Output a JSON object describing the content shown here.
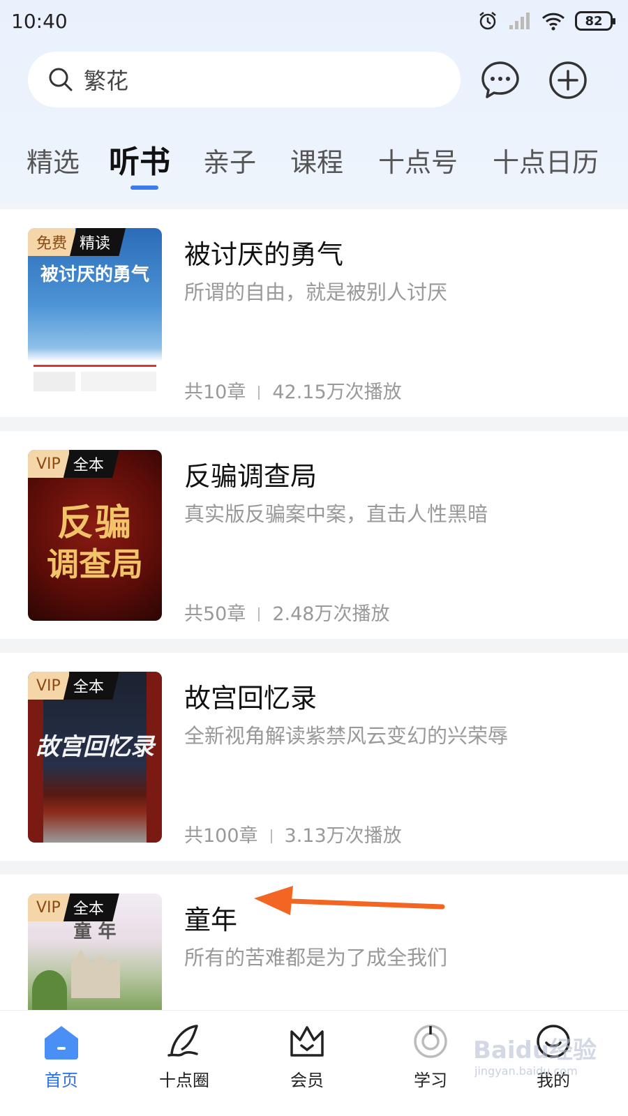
{
  "status_bar": {
    "time": "10:40",
    "battery": "82"
  },
  "search": {
    "placeholder": "繁花"
  },
  "tabs": [
    "精选",
    "听书",
    "亲子",
    "课程",
    "十点号",
    "十点日历"
  ],
  "active_tab": "听书",
  "books": [
    {
      "title": "被讨厌的勇气",
      "desc": "所谓的自由，就是被别人讨厌",
      "chapters": "共10章",
      "plays": "42.15万次播放",
      "badge_left": "免费",
      "badge_right": "精读",
      "cover_title": "被讨厌的勇气"
    },
    {
      "title": "反骗调查局",
      "desc": "真实版反骗案中案，直击人性黑暗",
      "chapters": "共50章",
      "plays": "2.48万次播放",
      "badge_left": "VIP",
      "badge_right": "全本",
      "cover_title_1": "反骗",
      "cover_title_2": "调查局"
    },
    {
      "title": "故宫回忆录",
      "desc": "全新视角解读紫禁风云变幻的兴荣辱",
      "chapters": "共100章",
      "plays": "3.13万次播放",
      "badge_left": "VIP",
      "badge_right": "全本",
      "cover_title": "故宫回忆录"
    },
    {
      "title": "童年",
      "desc": "所有的苦难都是为了成全我们",
      "badge_left": "VIP",
      "badge_right": "全本",
      "cover_title": "童 年"
    }
  ],
  "bottom_nav": [
    "首页",
    "十点圈",
    "会员",
    "学习",
    "我的"
  ],
  "watermark": {
    "text": "Baidu经验",
    "sub": "jingyan.baidu.com"
  },
  "colors": {
    "accent": "#3a7cf0",
    "arrow": "#f26522"
  }
}
